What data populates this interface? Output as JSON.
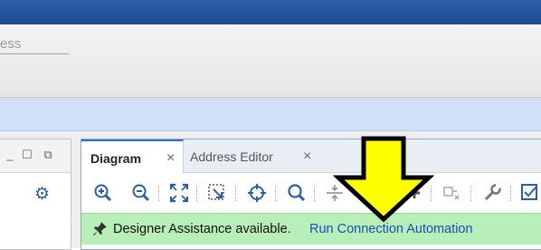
{
  "search": {
    "value": "ess"
  },
  "left_panel": {
    "minimize_glyph": "_",
    "maximize_glyph": "☐",
    "float_glyph": "⧉",
    "icon": "gear-icon"
  },
  "diagram_panel": {
    "tabs": [
      {
        "label": "Diagram",
        "active": true,
        "close": "×"
      },
      {
        "label": "Address Editor",
        "active": false,
        "close": "×"
      }
    ],
    "toolbar_icons": [
      "zoom-in-icon",
      "zoom-out-icon",
      "fit-view-icon",
      "zoom-selection-icon",
      "center-target-icon",
      "search-icon",
      "collapse-icon",
      "unknown-icon",
      "pin-icon",
      "port-icon",
      "wrench-icon",
      "validate-icon"
    ],
    "assistance": {
      "text": "Designer Assistance available.",
      "link": "Run Connection Automation"
    }
  },
  "annotation": {
    "type": "arrow-down",
    "color": "#ffff00"
  },
  "colors": {
    "titlebar": "#1f4c91",
    "info_strip": "#cfe0f8",
    "assist_bar": "#b8efb8",
    "link": "#1a4fb5",
    "icon_blue": "#2f5e9c"
  }
}
